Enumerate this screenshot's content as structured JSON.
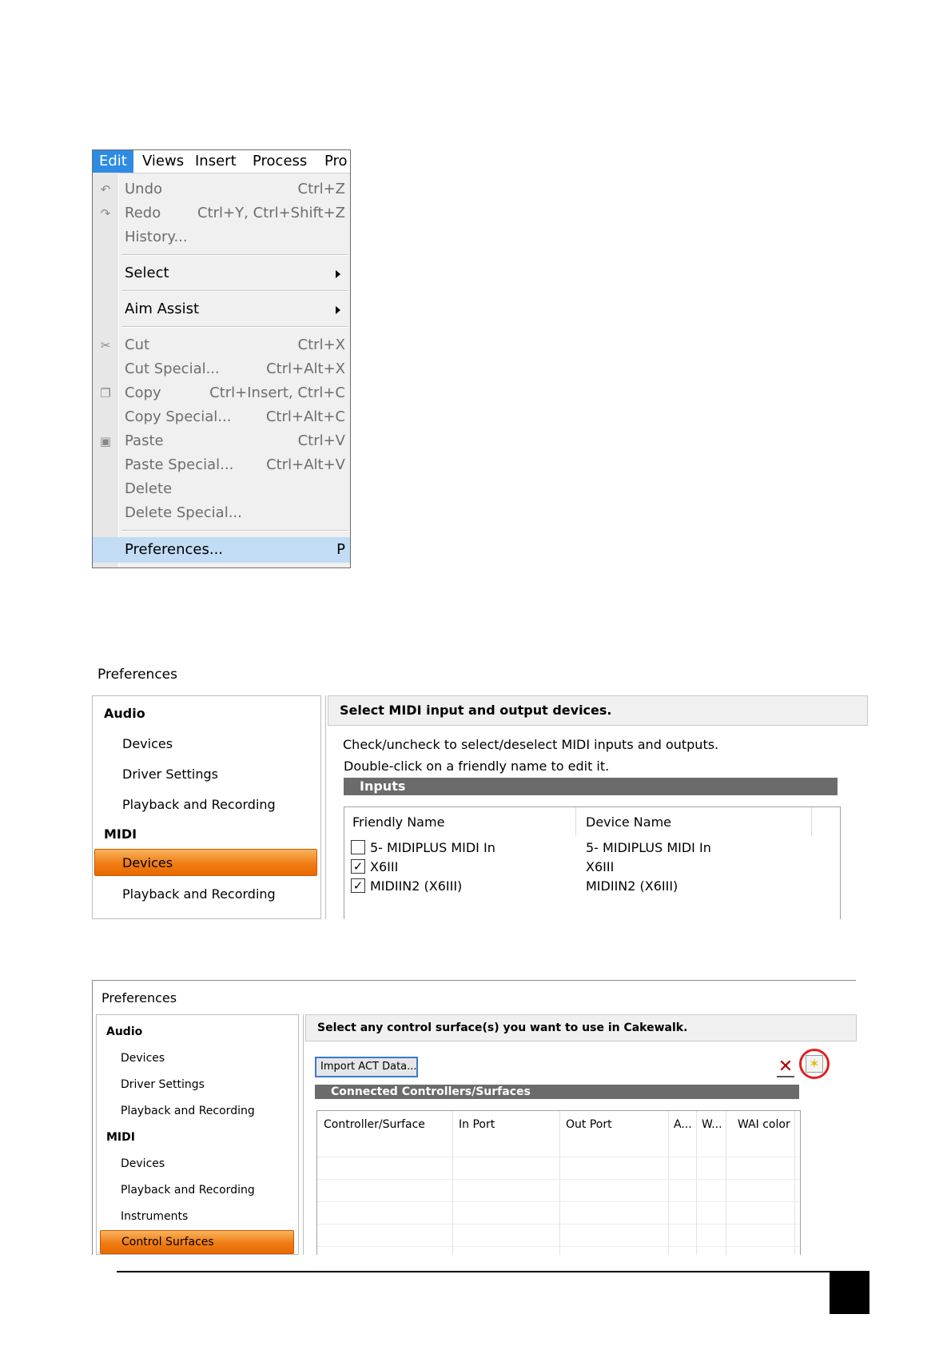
{
  "edit_menu": {
    "menubar": [
      "Edit",
      "Views",
      "Insert",
      "Process",
      "Pro"
    ],
    "items": [
      {
        "label": "Undo",
        "shortcut": "Ctrl+Z"
      },
      {
        "label": "Redo",
        "shortcut": "Ctrl+Y, Ctrl+Shift+Z"
      },
      {
        "label": "History..."
      },
      {
        "label": "Select"
      },
      {
        "label": "Aim Assist"
      },
      {
        "label": "Cut",
        "shortcut": "Ctrl+X"
      },
      {
        "label": "Cut Special...",
        "shortcut": "Ctrl+Alt+X"
      },
      {
        "label": "Copy",
        "shortcut": "Ctrl+Insert, Ctrl+C"
      },
      {
        "label": "Copy Special...",
        "shortcut": "Ctrl+Alt+C"
      },
      {
        "label": "Paste",
        "shortcut": "Ctrl+V"
      },
      {
        "label": "Paste Special...",
        "shortcut": "Ctrl+Alt+V"
      },
      {
        "label": "Delete"
      },
      {
        "label": "Delete Special..."
      },
      {
        "label": "Preferences...",
        "shortcut": "P"
      }
    ]
  },
  "prefs_midi": {
    "title": "Preferences",
    "tree": {
      "audio": "Audio",
      "audio_items": [
        "Devices",
        "Driver Settings",
        "Playback and Recording"
      ],
      "midi": "MIDI",
      "midi_items": [
        "Devices",
        "Playback and Recording"
      ]
    },
    "header": "Select MIDI input and output devices.",
    "instructions": [
      "Check/uncheck to select/deselect MIDI inputs and outputs.",
      "Double-click on a friendly name to edit it."
    ],
    "inputs_label": "Inputs",
    "columns": [
      "Friendly Name",
      "Device Name"
    ],
    "rows": [
      {
        "checked": false,
        "friendly": "5- MIDIPLUS MIDI In",
        "device": "5- MIDIPLUS MIDI In"
      },
      {
        "checked": true,
        "friendly": "X6III",
        "device": "X6III"
      },
      {
        "checked": true,
        "friendly": "MIDIIN2 (X6III)",
        "device": "MIDIIN2 (X6III)"
      }
    ]
  },
  "prefs_cs": {
    "title": "Preferences",
    "tree": {
      "audio": "Audio",
      "audio_items": [
        "Devices",
        "Driver Settings",
        "Playback and Recording"
      ],
      "midi": "MIDI",
      "midi_items": [
        "Devices",
        "Playback and Recording",
        "Instruments",
        "Control Surfaces"
      ]
    },
    "header": "Select any control surface(s) you want to use in Cakewalk.",
    "import_button": "Import ACT Data...",
    "connected_label": "Connected Controllers/Surfaces",
    "columns": [
      "Controller/Surface",
      "In Port",
      "Out Port",
      "A...",
      "W...",
      "WAI color"
    ],
    "icons": {
      "delete": "delete-x-icon",
      "add": "add-star-icon"
    },
    "highlight_color": "#e02020"
  }
}
